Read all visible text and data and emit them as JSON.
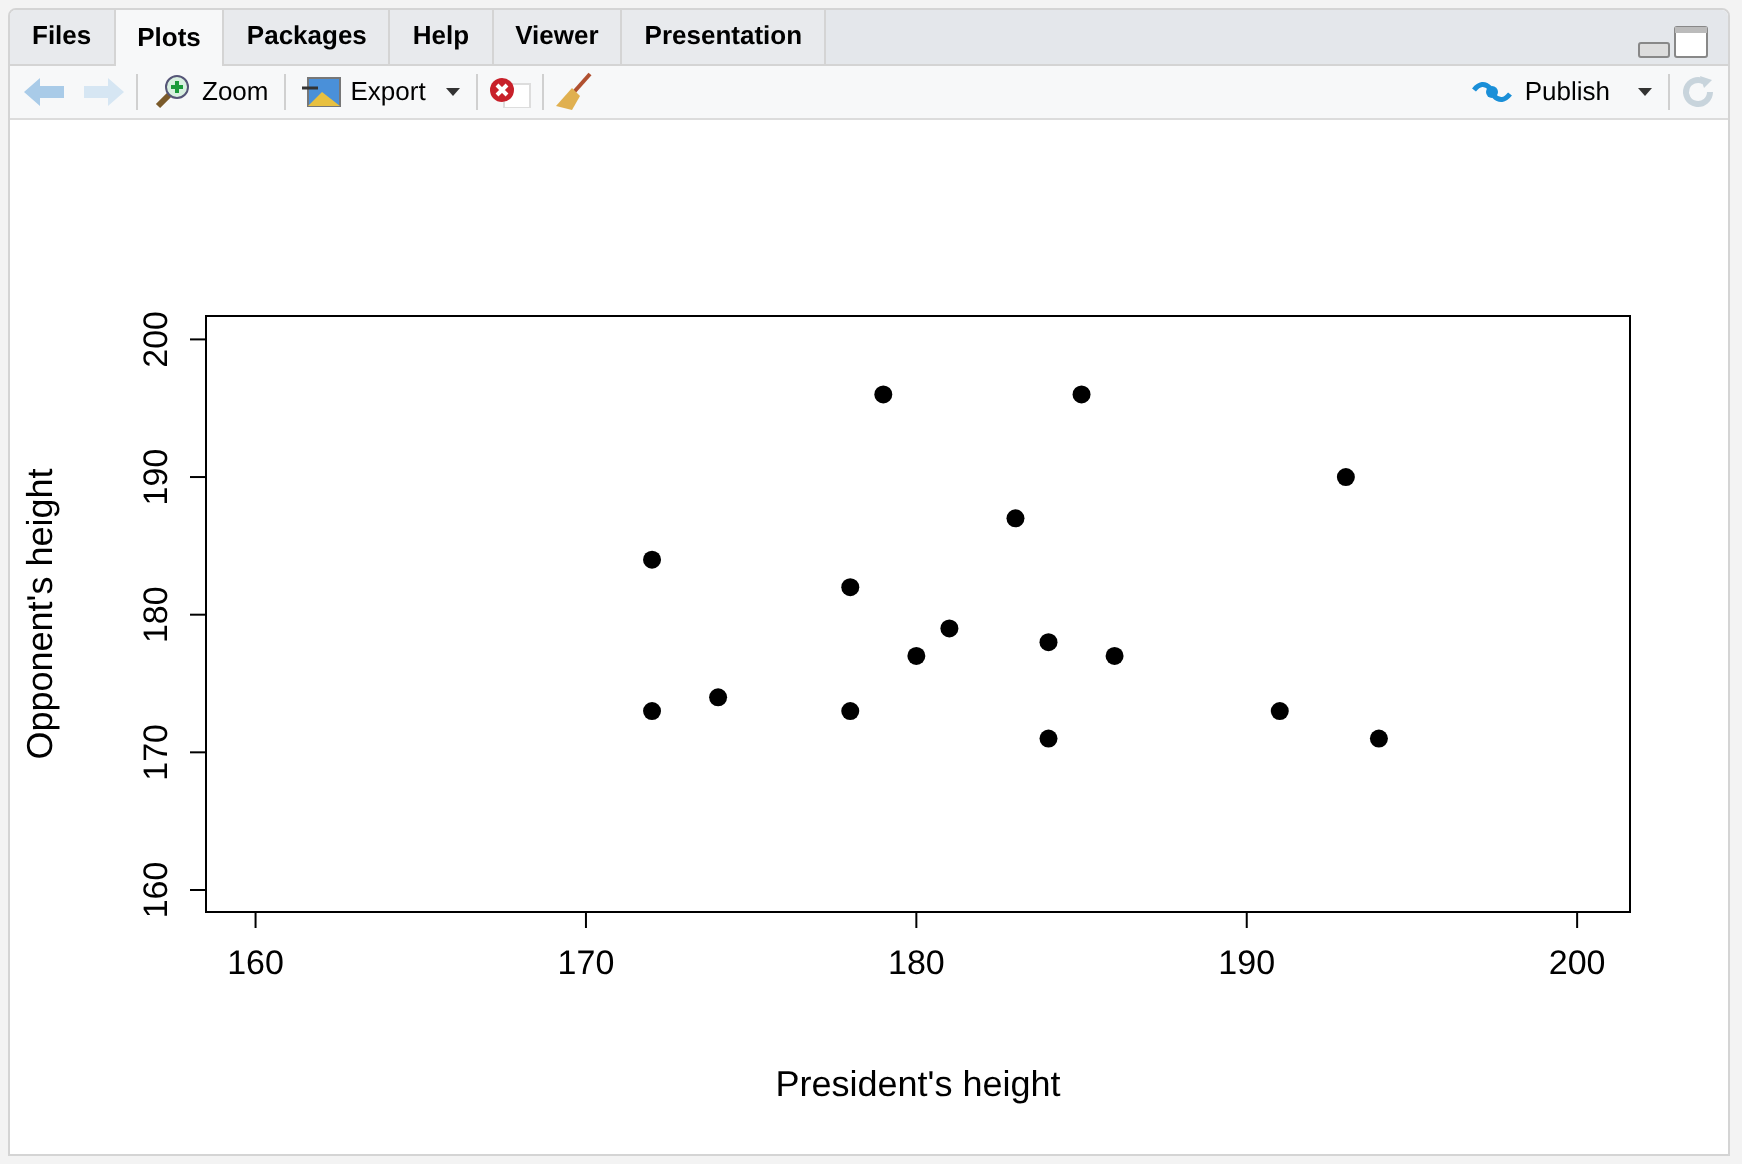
{
  "tabs": [
    {
      "label": "Files",
      "selected": false
    },
    {
      "label": "Plots",
      "selected": true
    },
    {
      "label": "Packages",
      "selected": false
    },
    {
      "label": "Help",
      "selected": false
    },
    {
      "label": "Viewer",
      "selected": false
    },
    {
      "label": "Presentation",
      "selected": false
    }
  ],
  "toolbar": {
    "zoom": "Zoom",
    "export": "Export",
    "publish": "Publish"
  },
  "plot": {
    "chart_data": {
      "type": "scatter",
      "xlabel": "President's height",
      "ylabel": "Opponent's height",
      "x": [
        172,
        172,
        174,
        178,
        178,
        179,
        180,
        181,
        183,
        184,
        184,
        185,
        186,
        191,
        193,
        194
      ],
      "series": [
        {
          "color": "#000000",
          "values": [
            184,
            173,
            174,
            182,
            173,
            196,
            177,
            179,
            187,
            178,
            171,
            196,
            177,
            173,
            190,
            171
          ]
        }
      ],
      "xlim": [
        158.5,
        201.6
      ],
      "ylim": [
        158.4,
        201.7
      ],
      "xticks": [
        160,
        170,
        180,
        190,
        200
      ],
      "yticks": [
        160,
        170,
        180,
        190,
        200
      ]
    }
  }
}
